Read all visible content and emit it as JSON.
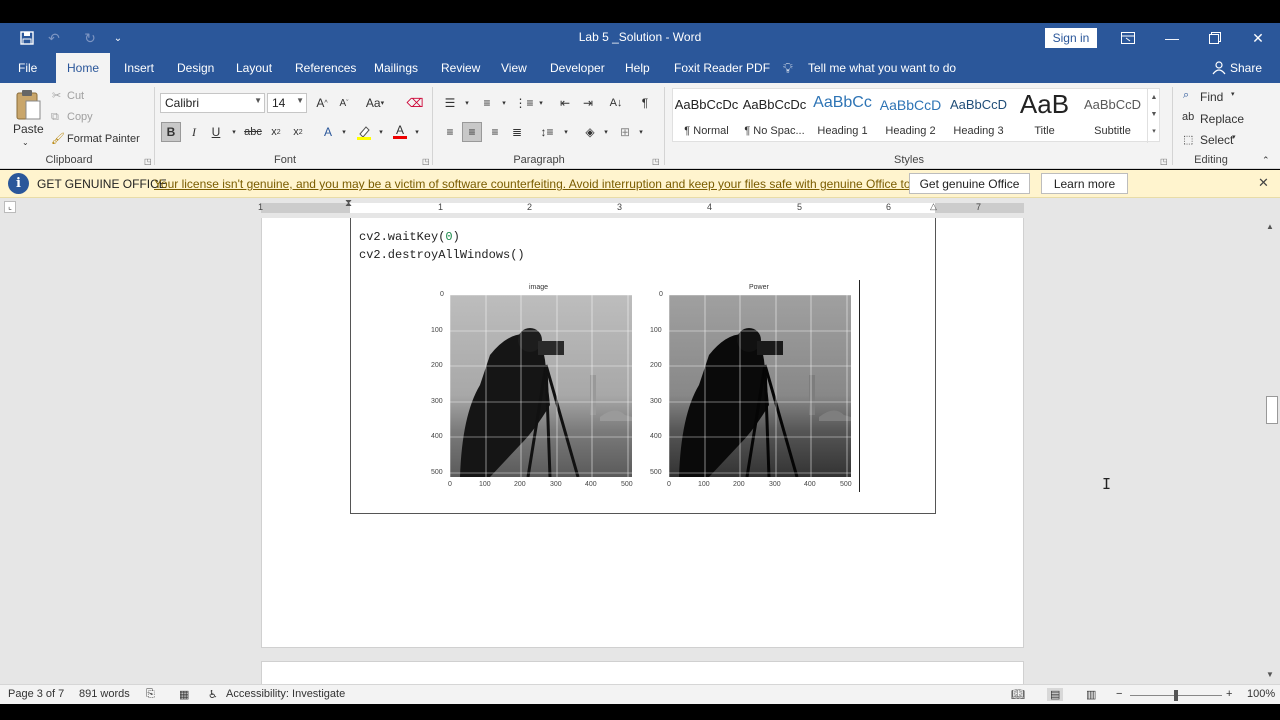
{
  "title_bar": {
    "title": "Lab 5 _Solution  -  Word",
    "sign_in": "Sign in"
  },
  "tabs": [
    "File",
    "Home",
    "Insert",
    "Design",
    "Layout",
    "References",
    "Mailings",
    "Review",
    "View",
    "Developer",
    "Help",
    "Foxit Reader PDF"
  ],
  "tell_me": "Tell me what you want to do",
  "share": "Share",
  "ribbon": {
    "clipboard": {
      "paste": "Paste",
      "cut": "Cut",
      "copy": "Copy",
      "format_painter": "Format Painter",
      "label": "Clipboard"
    },
    "font": {
      "name": "Calibri",
      "size": "14",
      "label": "Font"
    },
    "paragraph": {
      "label": "Paragraph"
    },
    "styles": {
      "label": "Styles",
      "items": [
        {
          "preview": "AaBbCcDc",
          "name": "¶ Normal"
        },
        {
          "preview": "AaBbCcDc",
          "name": "¶ No Spac..."
        },
        {
          "preview": "AaBbCc",
          "name": "Heading 1"
        },
        {
          "preview": "AaBbCcD",
          "name": "Heading 2"
        },
        {
          "preview": "AaBbCcD",
          "name": "Heading 3"
        },
        {
          "preview": "AaB",
          "name": "Title"
        },
        {
          "preview": "AaBbCcD",
          "name": "Subtitle"
        }
      ]
    },
    "editing": {
      "find": "Find",
      "replace": "Replace",
      "select": "Select",
      "label": "Editing"
    }
  },
  "message_bar": {
    "title": "GET GENUINE OFFICE",
    "text": "Your license isn't genuine, and you may be a victim of software counterfeiting. Avoid interruption and keep your files safe with genuine Office today.",
    "button_primary": "Get genuine Office",
    "button_secondary": "Learn more"
  },
  "ruler": {
    "numbers": [
      "1",
      "1",
      "2",
      "3",
      "4",
      "5",
      "6",
      "7"
    ]
  },
  "document": {
    "code_line1_a": "cv2.waitKey(",
    "code_line1_num": "0",
    "code_line1_b": ")",
    "code_line2": "cv2.destroyAllWindows()"
  },
  "figure": {
    "panels": [
      {
        "title": "image"
      },
      {
        "title": "Power"
      }
    ],
    "y_ticks": [
      "0",
      "100",
      "200",
      "300",
      "400",
      "500"
    ],
    "x_ticks": [
      "0",
      "100",
      "200",
      "300",
      "400",
      "500"
    ]
  },
  "status_bar": {
    "page": "Page 3 of 7",
    "words": "891 words",
    "accessibility": "Accessibility: Investigate",
    "zoom": "100%"
  },
  "colors": {
    "brand": "#2b579a",
    "message_bg": "#fff4ce"
  }
}
